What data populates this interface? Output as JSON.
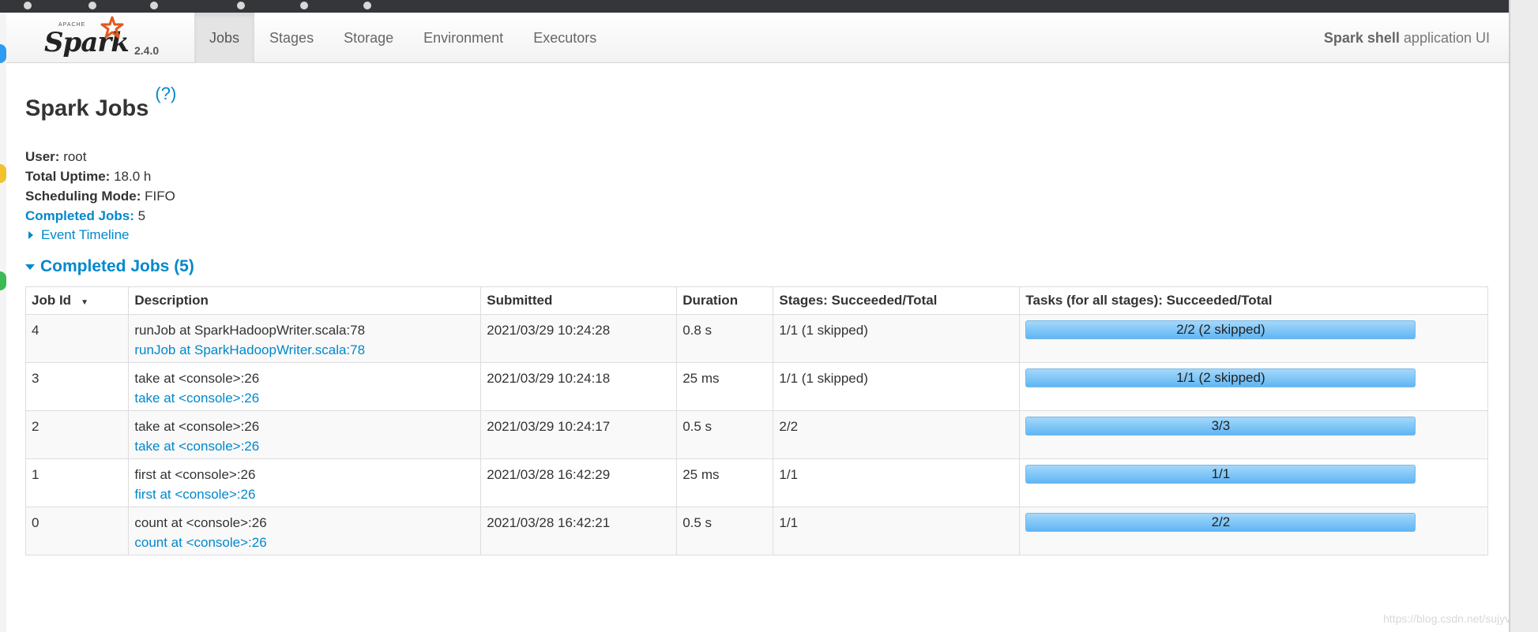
{
  "navbar": {
    "brand_apache": "APACHE",
    "brand_name": "Spark",
    "version": "2.4.0",
    "tabs": [
      {
        "label": "Jobs",
        "active": true
      },
      {
        "label": "Stages",
        "active": false
      },
      {
        "label": "Storage",
        "active": false
      },
      {
        "label": "Environment",
        "active": false
      },
      {
        "label": "Executors",
        "active": false
      }
    ],
    "app_name": "Spark shell",
    "app_suffix": " application UI"
  },
  "page": {
    "heading": "Spark Jobs",
    "help": "(?)"
  },
  "summary": {
    "user_label": "User:",
    "user_value": " root",
    "uptime_label": "Total Uptime:",
    "uptime_value": " 18.0 h",
    "mode_label": "Scheduling Mode:",
    "mode_value": " FIFO",
    "completed_label": "Completed Jobs:",
    "completed_value": " 5"
  },
  "event_timeline": "Event Timeline",
  "completed_section": "Completed Jobs (5)",
  "table": {
    "headers": [
      "Job Id",
      "Description",
      "Submitted",
      "Duration",
      "Stages: Succeeded/Total",
      "Tasks (for all stages): Succeeded/Total"
    ],
    "sort_indicator": "▼",
    "rows": [
      {
        "id": "4",
        "desc": "runJob at SparkHadoopWriter.scala:78",
        "desc_link": "runJob at SparkHadoopWriter.scala:78",
        "submitted": "2021/03/29 10:24:28",
        "duration": "0.8 s",
        "stages": "1/1 (1 skipped)",
        "tasks": "2/2 (2 skipped)",
        "task_progress": 1.0
      },
      {
        "id": "3",
        "desc": "take at <console>:26",
        "desc_link": "take at <console>:26",
        "submitted": "2021/03/29 10:24:18",
        "duration": "25 ms",
        "stages": "1/1 (1 skipped)",
        "tasks": "1/1 (2 skipped)",
        "task_progress": 1.0
      },
      {
        "id": "2",
        "desc": "take at <console>:26",
        "desc_link": "take at <console>:26",
        "submitted": "2021/03/29 10:24:17",
        "duration": "0.5 s",
        "stages": "2/2",
        "tasks": "3/3",
        "task_progress": 1.0
      },
      {
        "id": "1",
        "desc": "first at <console>:26",
        "desc_link": "first at <console>:26",
        "submitted": "2021/03/28 16:42:29",
        "duration": "25 ms",
        "stages": "1/1",
        "tasks": "1/1",
        "task_progress": 1.0
      },
      {
        "id": "0",
        "desc": "count at <console>:26",
        "desc_link": "count at <console>:26",
        "submitted": "2021/03/28 16:42:21",
        "duration": "0.5 s",
        "stages": "1/1",
        "tasks": "2/2",
        "task_progress": 1.0
      }
    ]
  },
  "watermark": "https://blog.csdn.net/sujyv",
  "colors": {
    "link": "#0088cc",
    "progress_fill": "#5fb6f4",
    "logo_star": "#e25a1c"
  }
}
